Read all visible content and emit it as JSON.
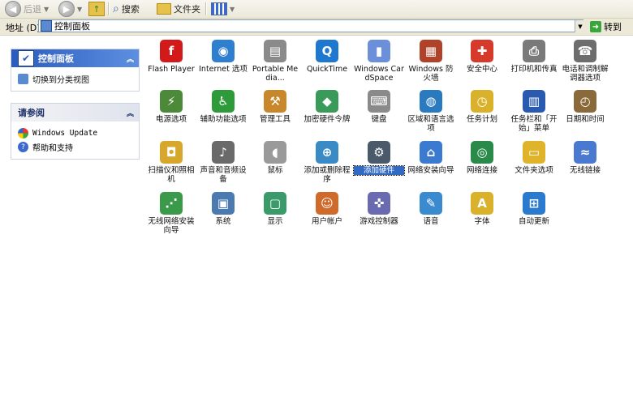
{
  "toolbar": {
    "back_label": "后退",
    "search_label": "搜索",
    "folders_label": "文件夹"
  },
  "address": {
    "label": "地址 (D)",
    "value": "控制面板",
    "go_label": "转到"
  },
  "left_pane": {
    "panel_title": "控制面板",
    "switch_view": "切换到分类视图",
    "see_also_title": "请参阅",
    "see_also": [
      "Windows Update",
      "帮助和支持"
    ]
  },
  "items": [
    {
      "label": "Flash Player",
      "icon": "flash-icon",
      "color": "#d21a1a",
      "glyph": "f"
    },
    {
      "label": "Internet 选项",
      "icon": "internet-options-icon",
      "color": "#2f7fd1",
      "glyph": "◉"
    },
    {
      "label": "Portable Media...",
      "icon": "portable-media-icon",
      "color": "#8a8a8a",
      "glyph": "▤"
    },
    {
      "label": "QuickTime",
      "icon": "quicktime-icon",
      "color": "#1f78d0",
      "glyph": "Q"
    },
    {
      "label": "Windows CardSpace",
      "icon": "cardspace-icon",
      "color": "#6c8fd9",
      "glyph": "▮"
    },
    {
      "label": "Windows 防火墙",
      "icon": "firewall-icon",
      "color": "#b0422a",
      "glyph": "▦"
    },
    {
      "label": "安全中心",
      "icon": "security-center-icon",
      "color": "#d63a2a",
      "glyph": "✚"
    },
    {
      "label": "打印机和传真",
      "icon": "printer-icon",
      "color": "#7a7a7a",
      "glyph": "⎙"
    },
    {
      "label": "电话和调制解调器选项",
      "icon": "phone-modem-icon",
      "color": "#6d6d6d",
      "glyph": "☎"
    },
    {
      "label": "电源选项",
      "icon": "power-options-icon",
      "color": "#4c8a3a",
      "glyph": "⚡"
    },
    {
      "label": "辅助功能选项",
      "icon": "accessibility-icon",
      "color": "#2e9a3a",
      "glyph": "♿"
    },
    {
      "label": "管理工具",
      "icon": "admin-tools-icon",
      "color": "#c8872a",
      "glyph": "⚒"
    },
    {
      "label": "加密硬件令牌",
      "icon": "crypto-token-icon",
      "color": "#3a9a5a",
      "glyph": "◆"
    },
    {
      "label": "键盘",
      "icon": "keyboard-icon",
      "color": "#8a8a8a",
      "glyph": "⌨"
    },
    {
      "label": "区域和语言选项",
      "icon": "regional-icon",
      "color": "#2a7ac0",
      "glyph": "◍"
    },
    {
      "label": "任务计划",
      "icon": "scheduled-tasks-icon",
      "color": "#d9b12a",
      "glyph": "◷"
    },
    {
      "label": "任务栏和「开始」菜单",
      "icon": "taskbar-icon",
      "color": "#2a5ab0",
      "glyph": "▥"
    },
    {
      "label": "日期和时间",
      "icon": "date-time-icon",
      "color": "#8a6a3a",
      "glyph": "◴"
    },
    {
      "label": "扫描仪和照相机",
      "icon": "scanner-camera-icon",
      "color": "#d6a72a",
      "glyph": "◘"
    },
    {
      "label": "声音和音频设备",
      "icon": "sound-icon",
      "color": "#6a6a6a",
      "glyph": "♪"
    },
    {
      "label": "鼠标",
      "icon": "mouse-icon",
      "color": "#9a9a9a",
      "glyph": "◖"
    },
    {
      "label": "添加或删除程序",
      "icon": "add-remove-programs-icon",
      "color": "#3a8ac6",
      "glyph": "⊕"
    },
    {
      "label": "添加硬件",
      "icon": "add-hardware-icon",
      "color": "#4a5a6a",
      "glyph": "⚙"
    },
    {
      "label": "网络安装向导",
      "icon": "network-setup-icon",
      "color": "#3a7ad0",
      "glyph": "⌂"
    },
    {
      "label": "网络连接",
      "icon": "network-connections-icon",
      "color": "#2a8a4a",
      "glyph": "◎"
    },
    {
      "label": "文件夹选项",
      "icon": "folder-options-icon",
      "color": "#e0b42a",
      "glyph": "▭"
    },
    {
      "label": "无线链接",
      "icon": "wireless-link-icon",
      "color": "#4a7ad0",
      "glyph": "≈"
    },
    {
      "label": "无线网络安装向导",
      "icon": "wireless-setup-icon",
      "color": "#3a9a4a",
      "glyph": "⋰"
    },
    {
      "label": "系统",
      "icon": "system-icon",
      "color": "#4a7ab0",
      "glyph": "▣"
    },
    {
      "label": "显示",
      "icon": "display-icon",
      "color": "#3a9a6a",
      "glyph": "▢"
    },
    {
      "label": "用户帐户",
      "icon": "user-accounts-icon",
      "color": "#d06a2a",
      "glyph": "☺"
    },
    {
      "label": "游戏控制器",
      "icon": "game-controller-icon",
      "color": "#6a6ab0",
      "glyph": "✜"
    },
    {
      "label": "语音",
      "icon": "speech-icon",
      "color": "#3a8ad0",
      "glyph": "✎"
    },
    {
      "label": "字体",
      "icon": "fonts-icon",
      "color": "#d9b12a",
      "glyph": "A"
    },
    {
      "label": "自动更新",
      "icon": "automatic-updates-icon",
      "color": "#2a7ad0",
      "glyph": "⊞"
    }
  ],
  "selected_item": "添加硬件"
}
